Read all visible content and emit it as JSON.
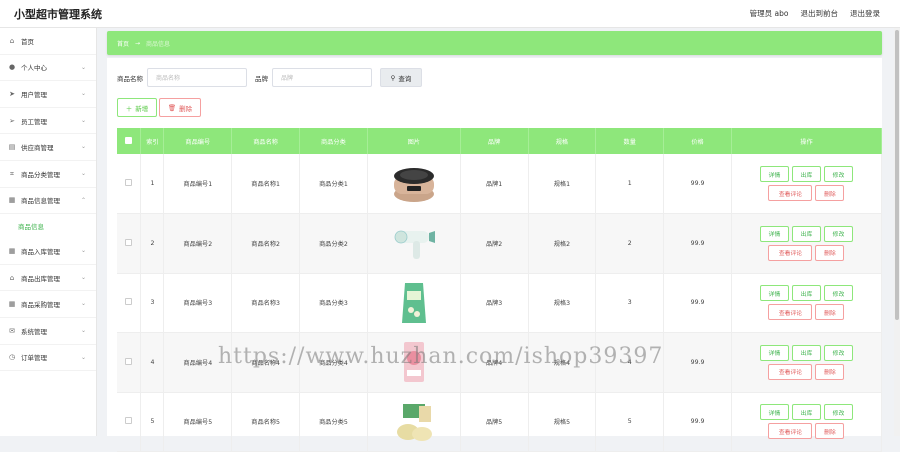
{
  "app": {
    "title": "小型超市管理系统"
  },
  "header": {
    "user_label": "管理员 abo",
    "back_label": "退出到前台",
    "logout_label": "退出登录"
  },
  "sidebar": {
    "items": [
      {
        "label": "首页",
        "icon": "home-icon"
      },
      {
        "label": "个人中心",
        "icon": "user-icon"
      },
      {
        "label": "用户管理",
        "icon": "send-icon"
      },
      {
        "label": "员工管理",
        "icon": "send-icon"
      },
      {
        "label": "供应商管理",
        "icon": "doc-icon"
      },
      {
        "label": "商品分类管理",
        "icon": "crop-icon"
      },
      {
        "label": "商品信息管理",
        "icon": "list-icon"
      }
    ],
    "sub_item": "商品信息",
    "items_after": [
      {
        "label": "商品入库管理",
        "icon": "list-icon"
      },
      {
        "label": "商品出库管理",
        "icon": "store-icon"
      },
      {
        "label": "商品采购管理",
        "icon": "grid-icon"
      },
      {
        "label": "系统管理",
        "icon": "mail-icon"
      },
      {
        "label": "订单管理",
        "icon": "clock-icon"
      }
    ]
  },
  "breadcrumb": {
    "root": "首页",
    "separator": "→",
    "current": "商品信息"
  },
  "search": {
    "name_label": "商品名称",
    "name_placeholder": "商品名称",
    "brand_label": "品牌",
    "brand_placeholder": "品牌",
    "button_label": "查询"
  },
  "actions": {
    "add_label": "新增",
    "delete_label": "删除"
  },
  "table": {
    "headers": [
      "",
      "索引",
      "商品编号",
      "商品名称",
      "商品分类",
      "图片",
      "品牌",
      "规格",
      "数量",
      "价格",
      "操作"
    ],
    "rows": [
      {
        "index": "1",
        "code": "商品编号1",
        "name": "商品名称1",
        "category": "商品分类1",
        "image": "rice-cooker",
        "brand": "品牌1",
        "spec": "规格1",
        "qty": "1",
        "price": "99.9"
      },
      {
        "index": "2",
        "code": "商品编号2",
        "name": "商品名称2",
        "category": "商品分类2",
        "image": "hair-dryer",
        "brand": "品牌2",
        "spec": "规格2",
        "qty": "2",
        "price": "99.9"
      },
      {
        "index": "3",
        "code": "商品编号3",
        "name": "商品名称3",
        "category": "商品分类3",
        "image": "snack-bag",
        "brand": "品牌3",
        "spec": "规格3",
        "qty": "3",
        "price": "99.9"
      },
      {
        "index": "4",
        "code": "商品编号4",
        "name": "商品名称4",
        "category": "商品分类4",
        "image": "pink-pack",
        "brand": "品牌4",
        "spec": "规格4",
        "qty": "4",
        "price": "99.9"
      },
      {
        "index": "5",
        "code": "商品编号5",
        "name": "商品名称5",
        "category": "商品分类5",
        "image": "buns",
        "brand": "品牌5",
        "spec": "规格5",
        "qty": "5",
        "price": "99.9"
      }
    ],
    "ops": {
      "detail": "详情",
      "out": "出库",
      "edit": "修改",
      "review": "查看评论",
      "delete": "删除"
    }
  },
  "watermark": "https://www.huzhan.com/ishop39397",
  "colors": {
    "accent": "#8ee77b",
    "accent_text": "#3bb24a",
    "danger": "#e05a5a"
  }
}
